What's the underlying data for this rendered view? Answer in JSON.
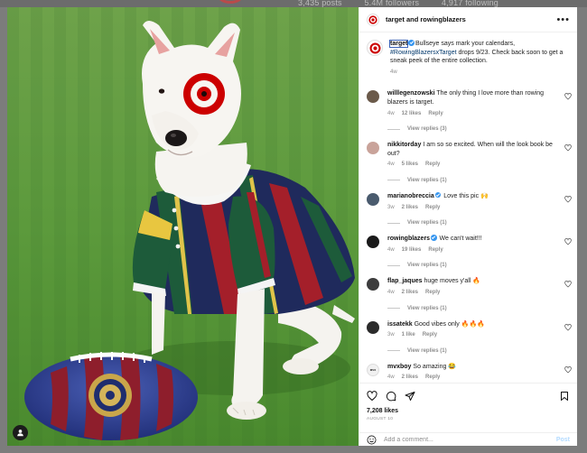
{
  "background": {
    "stats": [
      "3,435 posts",
      "5.4M followers",
      "4,917 following"
    ]
  },
  "post": {
    "header": {
      "account_primary": "target",
      "joiner": "and",
      "account_secondary": "rowingblazers",
      "more_label": "•••"
    },
    "caption": {
      "username": "target",
      "verified": true,
      "text_before": "Bullseye says mark your calendars, ",
      "hashtag": "#RowingBlazersxTarget",
      "text_after": " drops 9/23. Check back soon to get a sneak peek of the entire collection.",
      "time": "4w"
    },
    "comments": [
      {
        "username": "willlegenzowski",
        "verified": false,
        "text": "The only thing I love more than rowing blazers is target.",
        "time": "4w",
        "likes": "12 likes",
        "reply": "Reply",
        "view_replies": "View replies (3)",
        "avatar_color": "#6b5a4a"
      },
      {
        "username": "nikkitorday",
        "verified": false,
        "text": "I am so so excited. When will the look book be out?",
        "time": "4w",
        "likes": "5 likes",
        "reply": "Reply",
        "view_replies": "View replies (1)",
        "avatar_color": "#c9a39a"
      },
      {
        "username": "marianobreccia",
        "verified": true,
        "text": "Love this pic 🙌",
        "time": "3w",
        "likes": "2 likes",
        "reply": "Reply",
        "view_replies": "View replies (1)",
        "avatar_color": "#4a5b6e"
      },
      {
        "username": "rowingblazers",
        "verified": true,
        "text": "We can't wait!!!",
        "time": "4w",
        "likes": "19 likes",
        "reply": "Reply",
        "view_replies": "View replies (1)",
        "avatar_color": "#1a1a1a"
      },
      {
        "username": "flap_jaques",
        "verified": false,
        "text": "huge moves y'all 🔥",
        "time": "4w",
        "likes": "2 likes",
        "reply": "Reply",
        "view_replies": "View replies (1)",
        "avatar_color": "#3d3d3d"
      },
      {
        "username": "issatekk",
        "verified": false,
        "text": "Good vibes only 🔥🔥🔥",
        "time": "3w",
        "likes": "1 like",
        "reply": "Reply",
        "view_replies": "View replies (1)",
        "avatar_color": "#2b2b2b"
      },
      {
        "username": "mvxboy",
        "verified": false,
        "text": "So amazing 😂",
        "time": "4w",
        "likes": "2 likes",
        "reply": "Reply",
        "view_replies": "",
        "avatar_color": "#f1f1f1",
        "avatar_text": "MVX"
      }
    ],
    "likes": "7,208 likes",
    "date": "AUGUST 10",
    "add_comment_placeholder": "Add a comment...",
    "post_label": "Post"
  },
  "colors": {
    "target_red": "#cc0000",
    "link": "#00376b",
    "verified": "#3897f0"
  }
}
